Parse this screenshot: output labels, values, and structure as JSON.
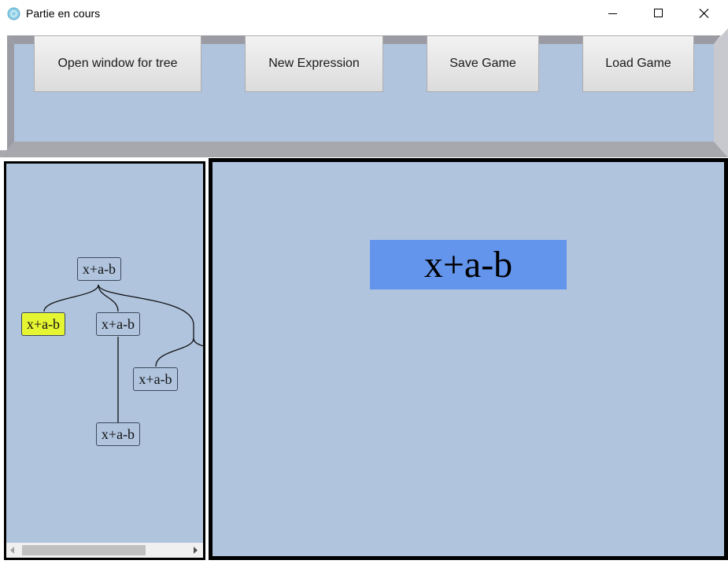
{
  "window": {
    "title": "Partie en cours",
    "icons": {
      "app": "app-logo-icon",
      "minimize": "minimize-icon",
      "maximize": "maximize-icon",
      "close": "close-icon"
    }
  },
  "toolbar": {
    "open_tree_label": "Open window for tree",
    "new_expression_label": "New Expression",
    "save_game_label": "Save Game",
    "load_game_label": "Load Game"
  },
  "tree": {
    "nodes": [
      {
        "label": "x+a-b",
        "selected": false
      },
      {
        "label": "x+a-b",
        "selected": true
      },
      {
        "label": "x+a-b",
        "selected": false
      },
      {
        "label": "x+a-b",
        "selected": false
      },
      {
        "label": "x+a-b",
        "selected": false
      }
    ],
    "highlight_color": "#e6f532",
    "scrollbar_icons": {
      "left": "scroll-left-arrow-icon",
      "right": "scroll-right-arrow-icon"
    }
  },
  "expression": {
    "current": "x+a-b",
    "box_color": "#6495ed"
  },
  "colors": {
    "panel_background": "#b0c4de",
    "frame_border": "#a0a0a8"
  }
}
